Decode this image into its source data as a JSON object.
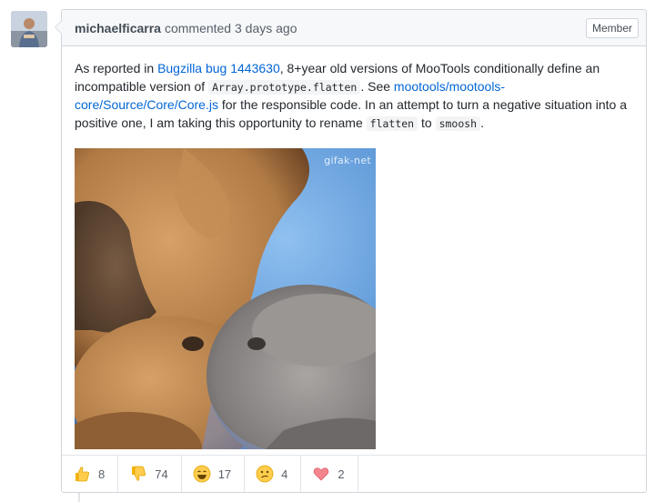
{
  "comment": {
    "author": "michaelficarra",
    "action": "commented",
    "time": "3 days ago",
    "badge": "Member"
  },
  "body": {
    "t1": "As reported in ",
    "link1": "Bugzilla bug 1443630",
    "t2": ", 8+year old versions of MooTools conditionally define an incompatible version of ",
    "code1": "Array.prototype.flatten",
    "t3": ". See ",
    "link2": "mootools/mootools-core/Source/Core/Core.js",
    "t4": " for the responsible code. In an attempt to turn a negative situation into a positive one, I am taking this opportunity to rename ",
    "code2": "flatten",
    "t5": " to ",
    "code3": "smoosh",
    "t6": "."
  },
  "gif": {
    "watermark": "gifak-net"
  },
  "reactions": [
    {
      "icon": "thumbs-up-icon",
      "count": "8"
    },
    {
      "icon": "thumbs-down-icon",
      "count": "74"
    },
    {
      "icon": "laugh-icon",
      "count": "17"
    },
    {
      "icon": "confused-icon",
      "count": "4"
    },
    {
      "icon": "heart-icon",
      "count": "2"
    }
  ],
  "colors": {
    "link": "#0366d6",
    "header_bg": "#f6f8fa",
    "border": "#d1d5da"
  }
}
